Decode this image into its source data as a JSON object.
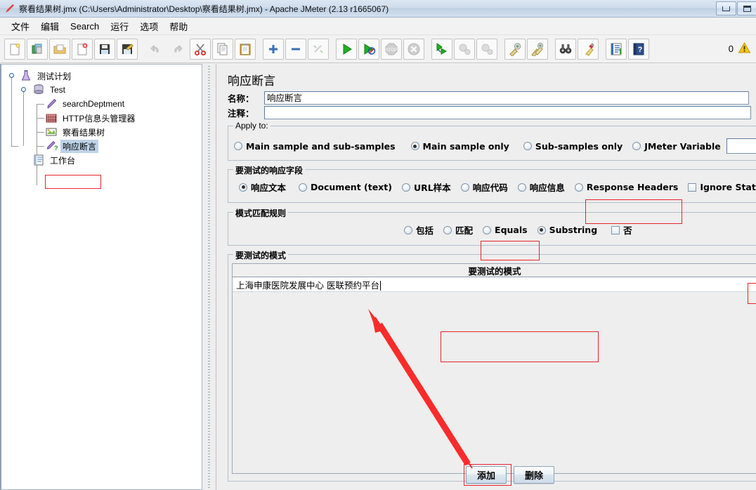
{
  "window": {
    "title": "察看结果树.jmx (C:\\Users\\Administrator\\Desktop\\察看结果树.jmx) - Apache JMeter (2.13 r1665067)",
    "icon": "jmeter-feather-icon",
    "minimize_label": "–",
    "maximize_label": "□"
  },
  "menubar": {
    "items": [
      {
        "label": "文件",
        "name": "menu-file"
      },
      {
        "label": "编辑",
        "name": "menu-edit"
      },
      {
        "label": "Search",
        "name": "menu-search"
      },
      {
        "label": "运行",
        "name": "menu-run"
      },
      {
        "label": "选项",
        "name": "menu-options"
      },
      {
        "label": "帮助",
        "name": "menu-help"
      }
    ]
  },
  "toolbar": {
    "buttons": [
      {
        "icon": "new-document-icon",
        "enabled": true
      },
      {
        "icon": "templates-icon",
        "enabled": true
      },
      {
        "icon": "open-folder-icon",
        "enabled": true
      },
      {
        "icon": "close-document-icon",
        "enabled": true
      },
      {
        "icon": "save-icon",
        "enabled": true
      },
      {
        "icon": "save-as-icon",
        "enabled": true
      },
      {
        "icon": "undo-icon",
        "enabled": false
      },
      {
        "icon": "redo-icon",
        "enabled": false
      },
      {
        "icon": "cut-scissors-icon",
        "enabled": true
      },
      {
        "icon": "copy-icon",
        "enabled": true
      },
      {
        "icon": "paste-clipboard-icon",
        "enabled": true
      },
      {
        "icon": "expand-plus-icon",
        "enabled": true
      },
      {
        "icon": "collapse-minus-icon",
        "enabled": true
      },
      {
        "icon": "toggle-icon",
        "enabled": false
      },
      {
        "icon": "start-play-icon",
        "enabled": true
      },
      {
        "icon": "start-no-timers-icon",
        "enabled": true
      },
      {
        "icon": "stop-icon",
        "enabled": false
      },
      {
        "icon": "shutdown-icon",
        "enabled": false
      },
      {
        "icon": "remote-start-all-icon",
        "enabled": true
      },
      {
        "icon": "remote-stop-all-icon",
        "enabled": false
      },
      {
        "icon": "remote-shutdown-all-icon",
        "enabled": false
      },
      {
        "icon": "clear-icon",
        "enabled": true
      },
      {
        "icon": "clear-all-icon",
        "enabled": true
      },
      {
        "icon": "search-binoculars-icon",
        "enabled": true
      },
      {
        "icon": "reset-search-icon",
        "enabled": true
      },
      {
        "icon": "function-helper-icon",
        "enabled": true
      },
      {
        "icon": "help-book-icon",
        "enabled": true
      }
    ],
    "error_count": "0",
    "warning_icon": "warning-triangle-icon"
  },
  "tree": {
    "nodes": [
      {
        "label": "测试计划",
        "icon": "test-plan-icon",
        "depth": 0,
        "selected": false,
        "expanded": true
      },
      {
        "label": "Test",
        "icon": "thread-group-icon",
        "depth": 1,
        "selected": false,
        "expanded": true
      },
      {
        "label": "searchDeptment",
        "icon": "http-sampler-icon",
        "depth": 2,
        "selected": false,
        "expanded": false
      },
      {
        "label": "HTTP信息头管理器",
        "icon": "header-manager-icon",
        "depth": 2,
        "selected": false,
        "expanded": false
      },
      {
        "label": "察看结果树",
        "icon": "view-results-tree-icon",
        "depth": 2,
        "selected": false,
        "expanded": false
      },
      {
        "label": "响应断言",
        "icon": "response-assertion-icon",
        "depth": 2,
        "selected": true,
        "expanded": false
      },
      {
        "label": "工作台",
        "icon": "workbench-icon",
        "depth": 0,
        "selected": false,
        "expanded": false
      }
    ]
  },
  "panel": {
    "title": "响应断言",
    "name_label": "名称：",
    "name_value": "响应断言",
    "comment_label": "注释：",
    "comment_value": "",
    "apply_to": {
      "legend": "Apply to:",
      "options": [
        {
          "label": "Main sample and sub-samples",
          "selected": false
        },
        {
          "label": "Main sample only",
          "selected": true,
          "highlighted": true
        },
        {
          "label": "Sub-samples only",
          "selected": false
        },
        {
          "label": "JMeter Variable",
          "selected": false
        }
      ],
      "variable_value": ""
    },
    "response_field": {
      "legend": "要测试的响应字段",
      "options": [
        {
          "label": "响应文本",
          "selected": true,
          "highlighted": true
        },
        {
          "label": "Document (text)",
          "selected": false
        },
        {
          "label": "URL样本",
          "selected": false
        },
        {
          "label": "响应代码",
          "selected": false
        },
        {
          "label": "响应信息",
          "selected": false
        },
        {
          "label": "Response Headers",
          "selected": false
        }
      ],
      "ignore_status": {
        "label": "Ignore Status",
        "checked": false
      }
    },
    "pattern_rules": {
      "legend": "模式匹配规则",
      "options": [
        {
          "label": "包括",
          "selected": false
        },
        {
          "label": "匹配",
          "selected": false
        },
        {
          "label": "Equals",
          "selected": false
        },
        {
          "label": "Substring",
          "selected": true,
          "highlighted": true
        }
      ],
      "not_checkbox": {
        "label": "否",
        "checked": false
      }
    },
    "patterns": {
      "legend": "要测试的模式",
      "column_header": "要测试的模式",
      "rows": [
        {
          "value": "上海申康医院发展中心 医联预约平台",
          "editing": true
        }
      ]
    },
    "buttons": {
      "add": "添加",
      "delete": "删除"
    }
  },
  "annotations": {
    "arrow_color": "#fb2b2b",
    "box_color": "#e8242a"
  }
}
